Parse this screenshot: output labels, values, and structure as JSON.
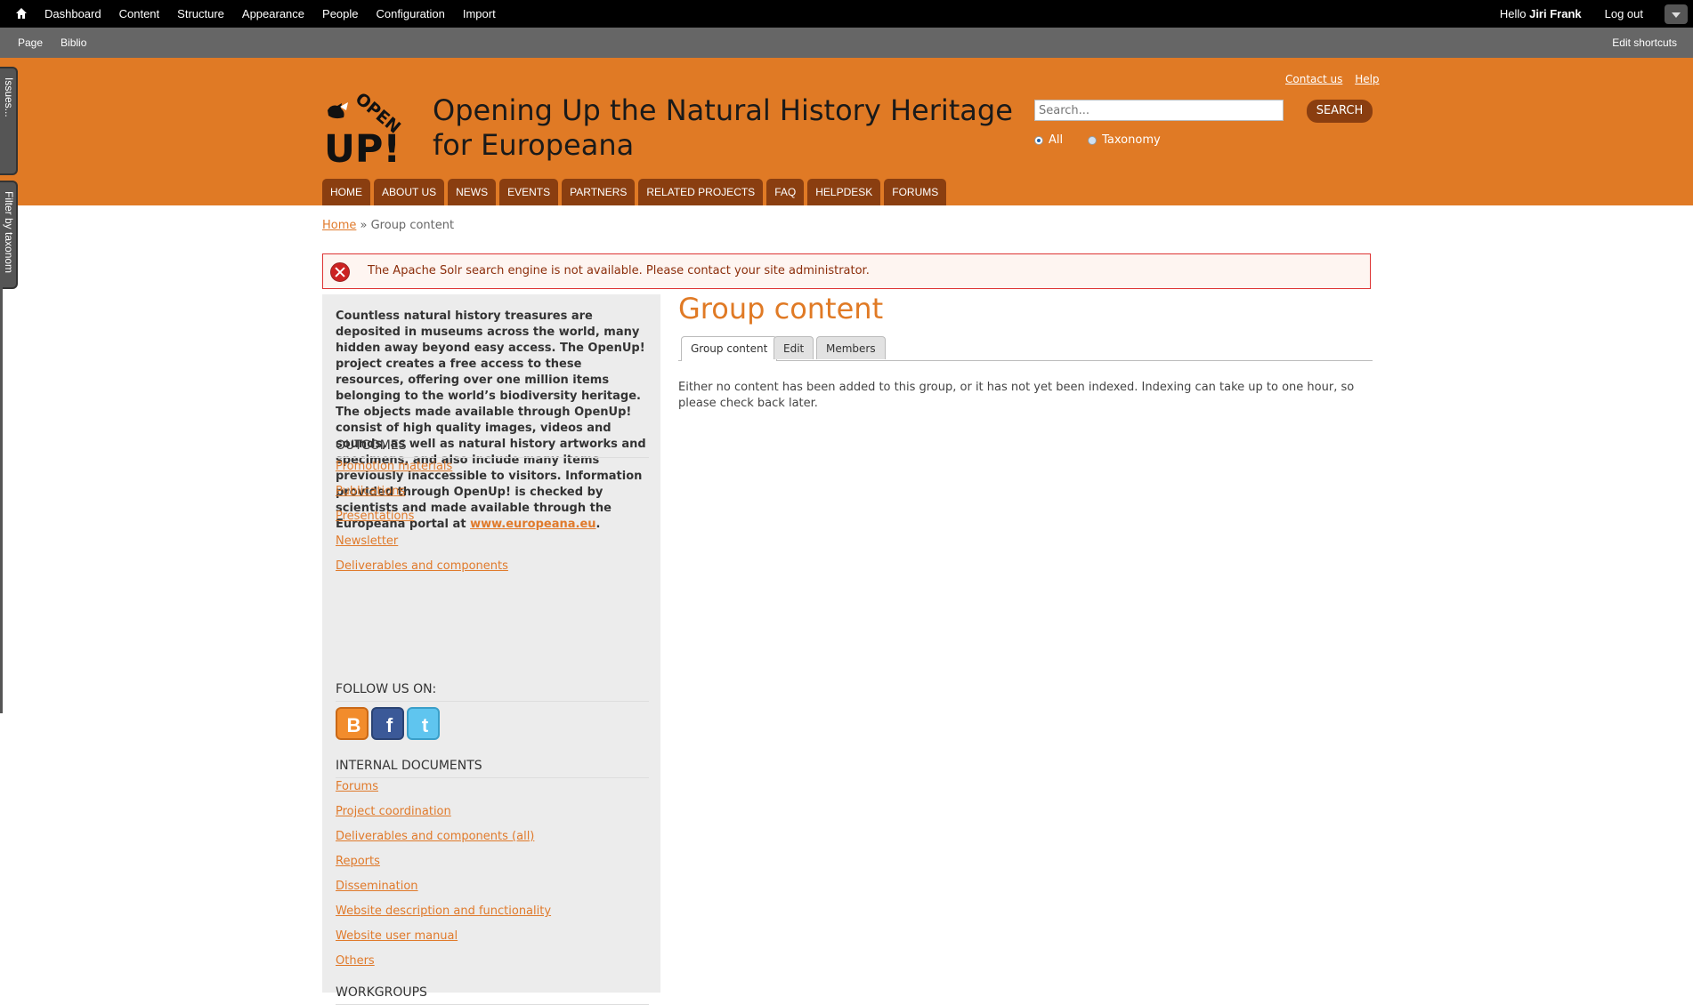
{
  "toolbar": {
    "menu": [
      "Dashboard",
      "Content",
      "Structure",
      "Appearance",
      "People",
      "Configuration",
      "Import"
    ],
    "greeting": "Hello",
    "user": "Jiri Frank",
    "logout": "Log out"
  },
  "shortcuts": {
    "items": [
      "Page",
      "Biblio"
    ],
    "edit": "Edit shortcuts"
  },
  "sidetabs": {
    "issues": "Issues...",
    "filter": "Filter by taxonom"
  },
  "header": {
    "site_title_line1": "Opening Up the Natural History Heritage",
    "site_title_line2": "for Europeana",
    "contact": "Contact us",
    "help": "Help",
    "search_placeholder": "Search...",
    "search_button": "SEARCH",
    "radio_all": "All",
    "radio_taxonomy": "Taxonomy",
    "logo_open": "OPEN",
    "logo_up": "UP!"
  },
  "nav": [
    "HOME",
    "ABOUT US",
    "NEWS",
    "EVENTS",
    "PARTNERS",
    "RELATED PROJECTS",
    "FAQ",
    "HELPDESK",
    "FORUMS"
  ],
  "breadcrumb": {
    "home": "Home",
    "sep": " » ",
    "current": "Group content"
  },
  "error": {
    "message": "The Apache Solr search engine is not available. Please contact your site administrator."
  },
  "sidebar": {
    "intro": "Countless natural history treasures are deposited in museums across the world, many hidden away beyond easy access. The OpenUp! project creates a free access to these resources, offering over one million items belonging to the world’s biodiversity heritage. The objects made available through OpenUp! consist of high quality images, videos and sounds, as well as natural history artworks and specimens, and also include many items previously inaccessible to visitors. Information provided through OpenUp! is checked by scientists and made available through the Europeana portal at",
    "intro_link": "www.europeana.eu",
    "intro_end": ".",
    "outcomes_title": "OUTCOMES",
    "outcomes": [
      "Promotion materials",
      "Publications",
      "Presentations",
      "Newsletter",
      "Deliverables and components"
    ],
    "follow_title": "FOLLOW US ON:",
    "internal_title": "INTERNAL DOCUMENTS",
    "internal": [
      "Forums",
      "Project coordination",
      "Deliverables and components (all)",
      "Reports",
      "Dissemination",
      "Website description and functionality",
      "Website user manual",
      "Others"
    ],
    "workgroups_title": "WORKGROUPS"
  },
  "main": {
    "title": "Group content",
    "tabs": [
      "Group content",
      "Edit",
      "Members"
    ],
    "message": "Either no content has been added to this group, or it has not yet been indexed. Indexing can take up to one hour, so please check back later."
  }
}
